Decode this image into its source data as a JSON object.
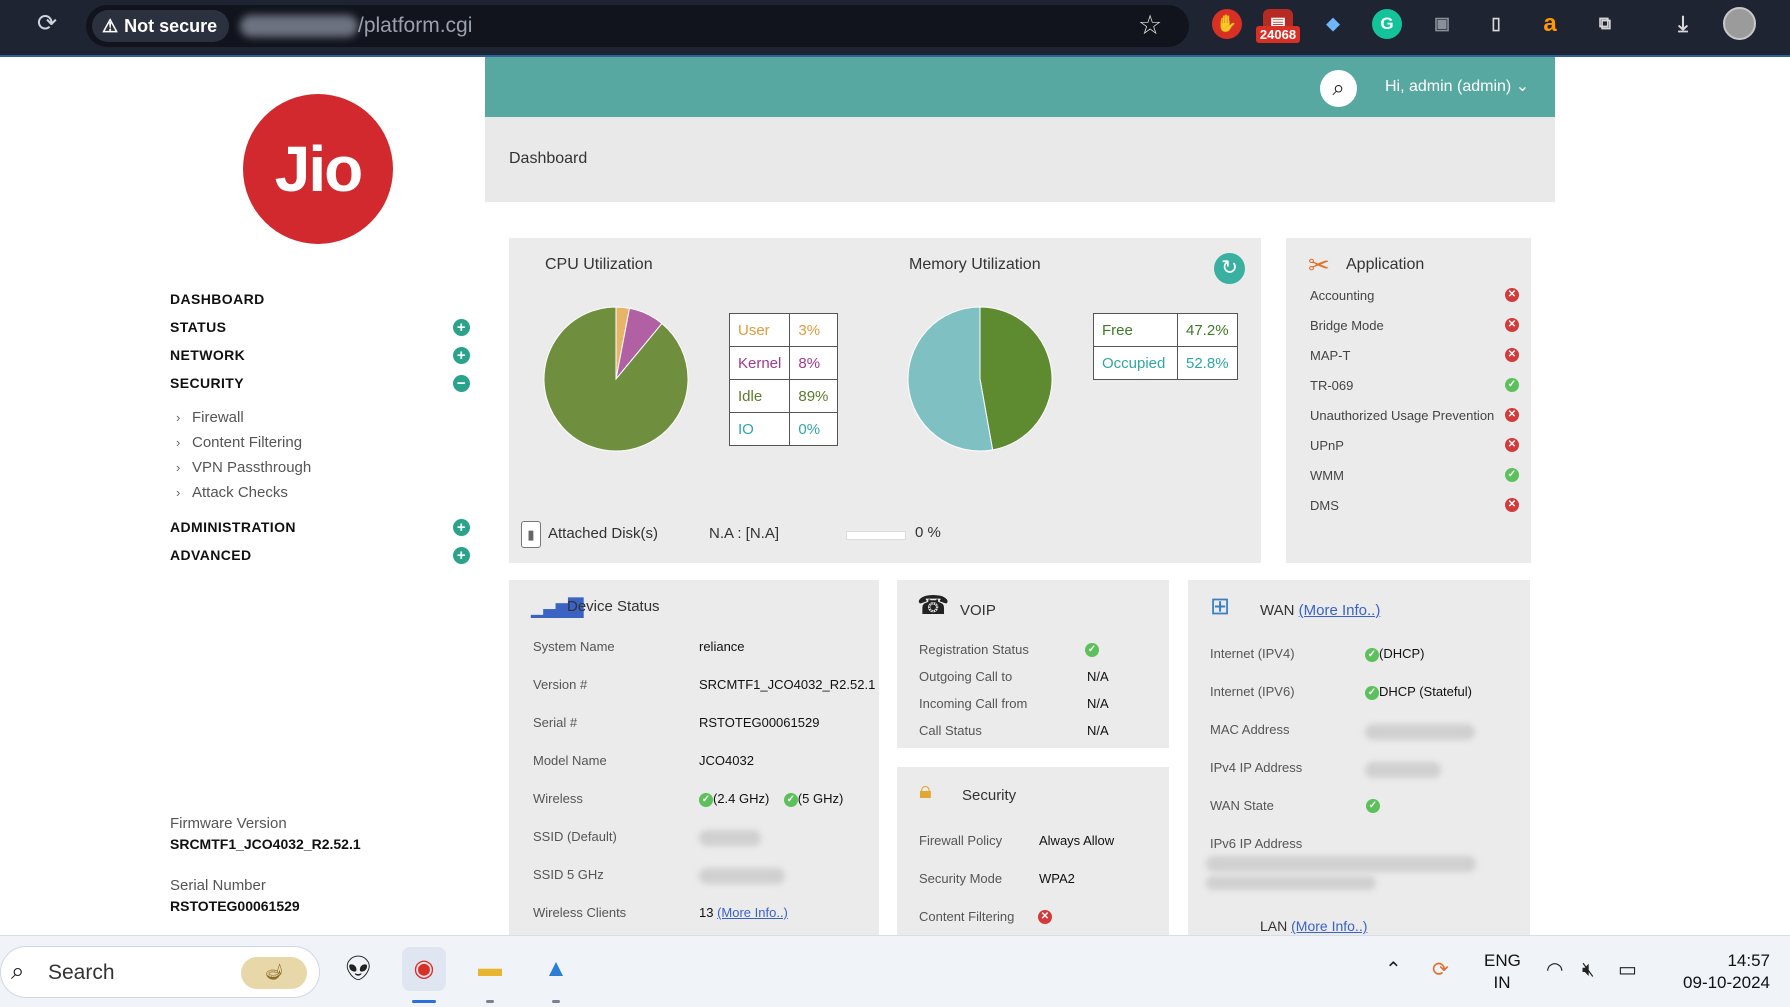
{
  "browser": {
    "security_label": "Not secure",
    "url_suffix": "/platform.cgi",
    "extension_badge": "24068"
  },
  "sidebar": {
    "logo_text": "Jio",
    "nav": [
      {
        "label": "DASHBOARD",
        "toggle": ""
      },
      {
        "label": "STATUS",
        "toggle": "+"
      },
      {
        "label": "NETWORK",
        "toggle": "+"
      },
      {
        "label": "SECURITY",
        "toggle": "−"
      }
    ],
    "security_subitems": [
      "Firewall",
      "Content Filtering",
      "VPN Passthrough",
      "Attack Checks"
    ],
    "nav_after": [
      {
        "label": "ADMINISTRATION",
        "toggle": "+"
      },
      {
        "label": "ADVANCED",
        "toggle": "+"
      }
    ],
    "firmware_label": "Firmware Version",
    "firmware_value": "SRCMTF1_JCO4032_R2.52.1",
    "serial_label": "Serial Number",
    "serial_value": "RSTOTEG00061529"
  },
  "header": {
    "user_label": "Hi, admin (admin)",
    "breadcrumb": "Dashboard"
  },
  "cpu": {
    "title": "CPU Utilization",
    "legend": [
      {
        "label": "User",
        "value": "3%",
        "color": "#e29a3b"
      },
      {
        "label": "Kernel",
        "value": "8%",
        "color": "#9b3c8c"
      },
      {
        "label": "Idle",
        "value": "89%",
        "color": "#5b7a2e"
      },
      {
        "label": "IO",
        "value": "0%",
        "color": "#2fa6a6"
      }
    ]
  },
  "memory": {
    "title": "Memory Utilization",
    "legend": [
      {
        "label": "Free",
        "value": "47.2%",
        "color": "#3f7a26"
      },
      {
        "label": "Occupied",
        "value": "52.8%",
        "color": "#2fa6a6"
      }
    ]
  },
  "disk": {
    "label": "Attached Disk(s)",
    "value": "N.A : [N.A]",
    "percent_text": "0 %",
    "progress": 0
  },
  "application": {
    "title": "Application",
    "items": [
      {
        "label": "Accounting",
        "status": "✕",
        "ok": false
      },
      {
        "label": "Bridge Mode",
        "status": "✕",
        "ok": false
      },
      {
        "label": "MAP-T",
        "status": "✕",
        "ok": false
      },
      {
        "label": "TR-069",
        "status": "✓",
        "ok": true
      },
      {
        "label": "Unauthorized Usage Prevention",
        "status": "✕",
        "ok": false
      },
      {
        "label": "UPnP",
        "status": "✕",
        "ok": false
      },
      {
        "label": "WMM",
        "status": "✓",
        "ok": true
      },
      {
        "label": "DMS",
        "status": "✕",
        "ok": false
      }
    ]
  },
  "device": {
    "title": "Device Status",
    "rows": [
      {
        "label": "System Name",
        "value": "reliance"
      },
      {
        "label": "Version #",
        "value": "SRCMTF1_JCO4032_R2.52.1"
      },
      {
        "label": "Serial #",
        "value": "RSTOTEG00061529"
      },
      {
        "label": "Model Name",
        "value": "JCO4032"
      },
      {
        "label": "Wireless",
        "value": ""
      },
      {
        "label": "SSID (Default)",
        "value": ""
      },
      {
        "label": "SSID 5 GHz",
        "value": ""
      },
      {
        "label": "Wireless Clients",
        "value": "13"
      }
    ],
    "wireless_24": "(2.4 GHz)",
    "wireless_5": "(5 GHz)",
    "clients_link": "(More Info..)"
  },
  "voip": {
    "title": "VOIP",
    "rows": [
      {
        "label": "Registration Status",
        "value": ""
      },
      {
        "label": "Outgoing Call to",
        "value": "N/A"
      },
      {
        "label": "Incoming Call from",
        "value": "N/A"
      },
      {
        "label": "Call Status",
        "value": "N/A"
      }
    ]
  },
  "security": {
    "title": "Security",
    "rows": [
      {
        "label": "Firewall Policy",
        "value": "Always Allow"
      },
      {
        "label": "Security Mode",
        "value": "WPA2"
      },
      {
        "label": "Content Filtering",
        "value": ""
      }
    ]
  },
  "wan": {
    "title": "WAN",
    "link": "(More Info..)",
    "rows": [
      {
        "label": "Internet (IPV4)",
        "value": "(DHCP)"
      },
      {
        "label": "Internet (IPV6)",
        "value": "DHCP (Stateful)"
      },
      {
        "label": "MAC Address",
        "value": ""
      },
      {
        "label": "IPv4 IP Address",
        "value": ""
      },
      {
        "label": "WAN State",
        "value": ""
      },
      {
        "label": "IPv6 IP Address",
        "value": ""
      }
    ],
    "lan_title": "LAN",
    "lan_link": "(More Info..)"
  },
  "taskbar": {
    "search_placeholder": "Search",
    "lang_top": "ENG",
    "lang_bottom": "IN",
    "time": "14:57",
    "date": "09-10-2024"
  },
  "chart_data": [
    {
      "type": "pie",
      "title": "CPU Utilization",
      "categories": [
        "User",
        "Kernel",
        "Idle",
        "IO"
      ],
      "values": [
        3,
        8,
        89,
        0
      ]
    },
    {
      "type": "pie",
      "title": "Memory Utilization",
      "categories": [
        "Free",
        "Occupied"
      ],
      "values": [
        47.2,
        52.8
      ]
    }
  ]
}
